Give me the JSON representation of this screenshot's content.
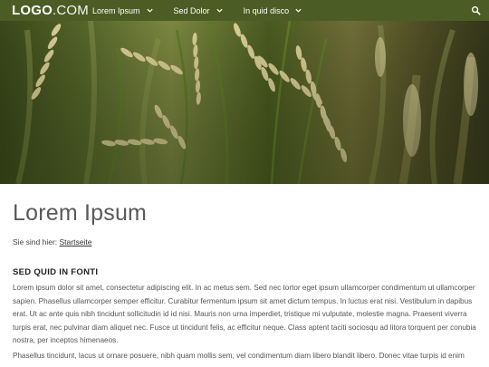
{
  "header": {
    "logo_main": "LOGO",
    "logo_tld": ".COM",
    "nav": [
      {
        "label": "Lorem Ipsum"
      },
      {
        "label": "Sed Dolor"
      },
      {
        "label": "In quid disco"
      }
    ],
    "bar_color": "#4b5d24"
  },
  "icons": {
    "search": "search-icon",
    "chevron": "chevron-down-icon"
  },
  "main": {
    "title": "Lorem Ipsum",
    "breadcrumb_prefix": "Sie sind hier:",
    "breadcrumb_link": "Startseite",
    "section_heading": "SED QUID IN FONTI",
    "paragraph1": "Lorem ipsum dolor sit amet, consectetur adipiscing elit. In ac metus sem. Sed nec tortor eget ipsum ullamcorper condimentum ut ullamcorper sapien. Phasellus ullamcorper semper efficitur. Curabitur fermentum ipsum sit amet dictum tempus. In luctus erat nisi. Vestibulum in dapibus erat. Ut ac ante quis nibh tincidunt sollicitudin id id nisi. Mauris non urna imperdiet, tristique mi vulputate, molestie magna. Praesent viverra turpis erat, nec pulvinar diam aliquet nec. Fusce ut tincidunt felis, ac efficitur neque. Class aptent taciti sociosqu ad litora torquent per conubia nostra, per inceptos himenaeos.",
    "paragraph2": "Phasellus tincidunt, lacus ut ornare posuere, nibh quam mollis sem, vel condimentum diam libero blandit libero. Donec vitae turpis id enim"
  }
}
